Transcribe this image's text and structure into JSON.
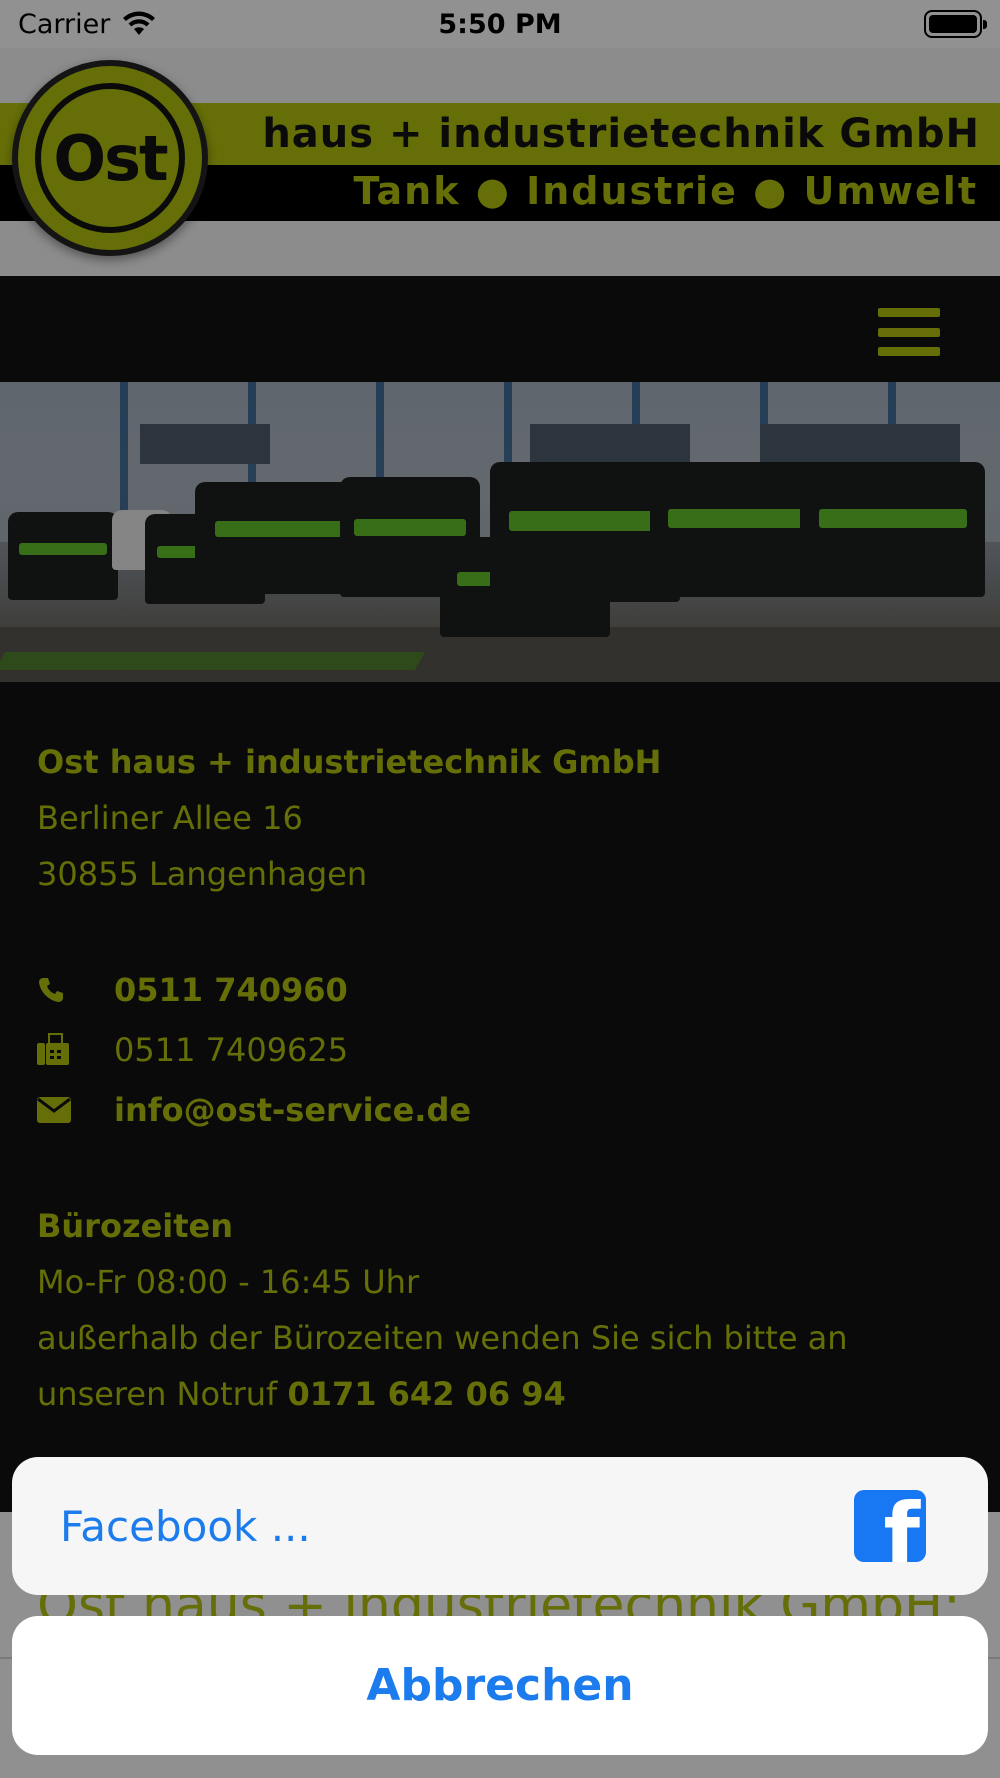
{
  "status_bar": {
    "carrier": "Carrier",
    "time": "5:50 PM"
  },
  "header": {
    "logo_badge_text": "Ost",
    "logo_line1": "haus + industrietechnik GmbH",
    "logo_line2": "Tank ● Industrie ● Umwelt",
    "accent_color": "#aab80d"
  },
  "navbar": {
    "menu_icon": "hamburger-menu-icon"
  },
  "contact": {
    "company": "Ost haus + industrietechnik GmbH",
    "street": "Berliner Allee 16",
    "city": "30855 Langenhagen",
    "phone": "0511 740960",
    "fax": "0511 7409625",
    "email": "info@ost-service.de",
    "phone_icon": "phone-icon",
    "fax_icon": "fax-icon",
    "email_icon": "envelope-icon"
  },
  "office_hours": {
    "heading": "Bürozeiten",
    "hours": "Mo-Fr 08:00 - 16:45 Uhr",
    "note_line1": "außerhalb der Bürozeiten wenden Sie sich bitte an",
    "note_line2_prefix": "unseren Notruf ",
    "emergency_number": "0171 642 06 94"
  },
  "footer": {
    "title": "Ost haus + industrietechnik GmbH:"
  },
  "action_sheet": {
    "option_label": "Facebook ...",
    "option_icon": "facebook-icon",
    "cancel_label": "Abbrechen",
    "text_color": "#1c7ced"
  }
}
